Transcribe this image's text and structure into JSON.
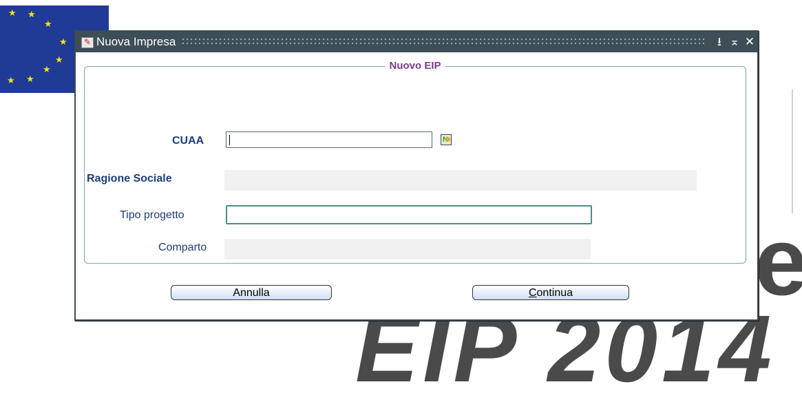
{
  "window": {
    "title": "Nuova Impresa",
    "controls": {
      "minimize": "⭳",
      "restore": "⌅",
      "close": "✕"
    }
  },
  "group": {
    "legend": "Nuovo EIP"
  },
  "form": {
    "cuaa_label": "CUAA",
    "cuaa_value": "",
    "ragione_sociale_label": "Ragione Sociale",
    "ragione_sociale_value": "",
    "tipo_progetto_label": "Tipo progetto",
    "tipo_progetto_value": "",
    "comparto_label": "Comparto",
    "comparto_value": ""
  },
  "buttons": {
    "annulla": "Annulla",
    "continua_prefix": "C",
    "continua_rest": "ontinua"
  },
  "background": {
    "text": "EIP 2014",
    "fragment": "e"
  },
  "colors": {
    "titlebar": "#3e4e57",
    "legend": "#7a3b8c",
    "label": "#1d3d7a",
    "flag": "#1f3b95"
  },
  "icons": {
    "app": "forms-app-icon",
    "lov": "list-of-values-icon"
  }
}
